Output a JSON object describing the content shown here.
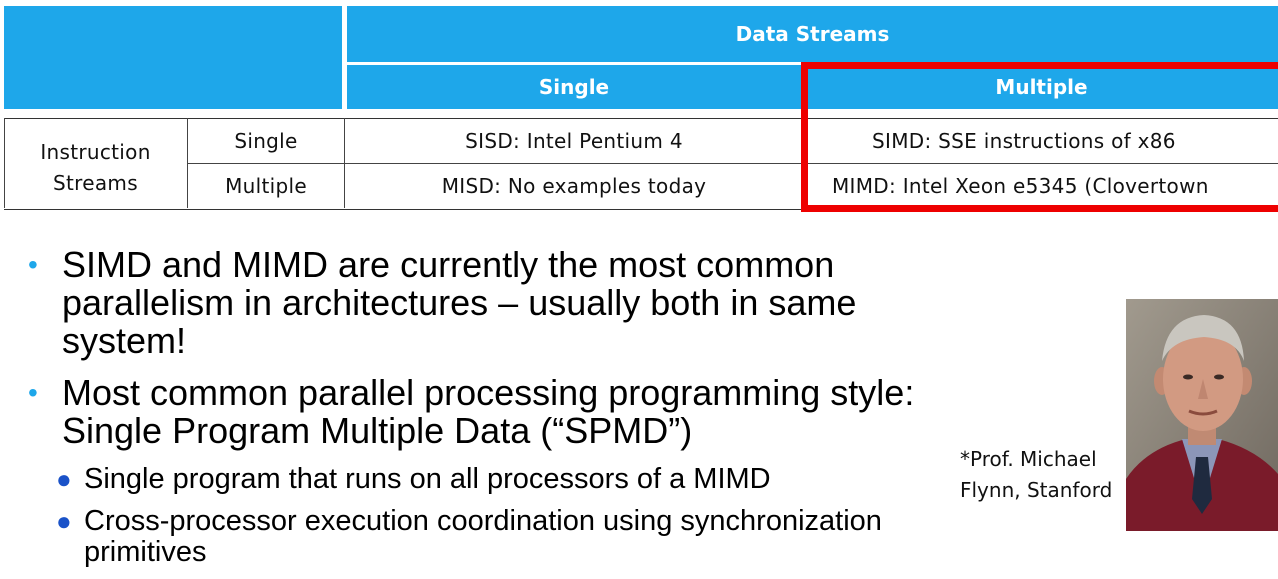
{
  "table": {
    "header": {
      "data_streams": "Data Streams",
      "single": "Single",
      "multiple": "Multiple"
    },
    "row_group": [
      "Instruction",
      "Streams"
    ],
    "rows": [
      {
        "label": "Single",
        "single": "SISD: Intel Pentium 4",
        "multiple": "SIMD: SSE instructions of x86"
      },
      {
        "label": "Multiple",
        "single": "MISD: No examples today",
        "multiple": "MIMD: Intel Xeon e5345 (Clovertown"
      }
    ]
  },
  "bullets": {
    "b1": "SIMD and MIMD are currently the most common parallelism in architectures – usually both in same system!",
    "b2": "Most common parallel processing programming style: Single Program Multiple Data (“SPMD”)",
    "sub1": "Single program that runs on all processors of a MIMD",
    "sub2": "Cross-processor execution coordination using synchronization primitives"
  },
  "caption": {
    "line1": "*Prof. Michael",
    "line2": "Flynn, Stanford"
  },
  "colors": {
    "header": "#1ea7ea",
    "highlight": "#ee0000",
    "bullet": "#1ea7ea",
    "sub_bullet": "#1a52c8"
  }
}
